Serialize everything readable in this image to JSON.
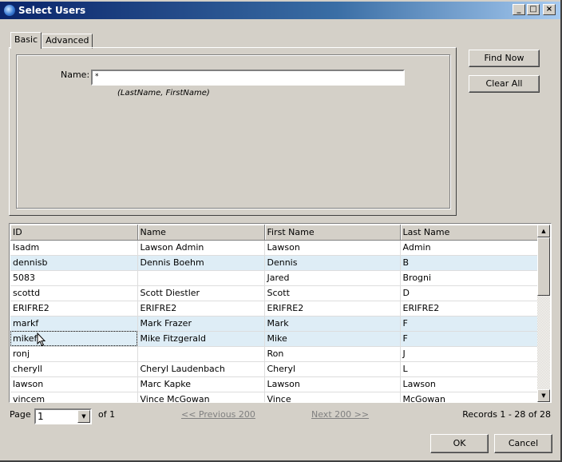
{
  "window": {
    "title": "Select Users",
    "controls": {
      "minimize": "_",
      "maximize": "□",
      "close": "×"
    }
  },
  "tabs": [
    {
      "label": "Basic",
      "active": true
    },
    {
      "label": "Advanced",
      "active": false
    }
  ],
  "search": {
    "name_label": "Name:",
    "name_value": "*",
    "hint": "(LastName, FirstName)"
  },
  "buttons": {
    "find_now": "Find Now",
    "clear_all": "Clear All",
    "ok": "OK",
    "cancel": "Cancel"
  },
  "table": {
    "columns": [
      "ID",
      "Name",
      "First Name",
      "Last Name"
    ],
    "rows": [
      {
        "id": "lsadm",
        "name": "Lawson Admin",
        "first": "Lawson",
        "last": "Admin",
        "highlight": false
      },
      {
        "id": "dennisb",
        "name": "Dennis Boehm",
        "first": "Dennis",
        "last": "B",
        "highlight": true
      },
      {
        "id": "5083",
        "name": "",
        "first": "Jared",
        "last": "Brogni",
        "highlight": false
      },
      {
        "id": "scottd",
        "name": "Scott Diestler",
        "first": "Scott",
        "last": "D",
        "highlight": false
      },
      {
        "id": "ERIFRE2",
        "name": "ERIFRE2",
        "first": "ERIFRE2",
        "last": "ERIFRE2",
        "highlight": false
      },
      {
        "id": "markf",
        "name": "Mark Frazer",
        "first": "Mark",
        "last": "F",
        "highlight": true
      },
      {
        "id": "mikef",
        "name": "Mike Fitzgerald",
        "first": "Mike",
        "last": "F",
        "highlight": true,
        "focused": true
      },
      {
        "id": "ronj",
        "name": "",
        "first": "Ron",
        "last": "J",
        "highlight": false
      },
      {
        "id": "cheryll",
        "name": "Cheryl Laudenbach",
        "first": "Cheryl",
        "last": "L",
        "highlight": false
      },
      {
        "id": "lawson",
        "name": "Marc Kapke",
        "first": "Lawson",
        "last": "Lawson",
        "highlight": false
      },
      {
        "id": "vincem",
        "name": "Vince McGowan",
        "first": "Vince",
        "last": "McGowan",
        "highlight": false
      }
    ]
  },
  "pagination": {
    "page_label": "Page",
    "page_value": "1",
    "of_label": "of 1",
    "previous": "<< Previous 200",
    "next": "Next 200 >>",
    "records": "Records 1 - 28 of 28"
  },
  "colors": {
    "highlight_row": "#deedf6",
    "title_start": "#0a246a",
    "title_end": "#a6caf0"
  }
}
